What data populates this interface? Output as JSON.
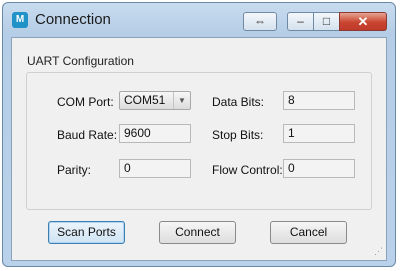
{
  "window": {
    "title": "Connection",
    "icon": "maxim-logo-icon",
    "buttons": {
      "switch": "⇔",
      "minimize": "–",
      "maximize": "□",
      "close": "✕"
    }
  },
  "group": {
    "title": "UART Configuration",
    "com_port": {
      "label": "COM Port:",
      "value": "COM51"
    },
    "data_bits": {
      "label": "Data Bits:",
      "value": "8"
    },
    "baud_rate": {
      "label": "Baud Rate:",
      "value": "9600"
    },
    "stop_bits": {
      "label": "Stop Bits:",
      "value": "1"
    },
    "parity": {
      "label": "Parity:",
      "value": "0"
    },
    "flow_control": {
      "label": "Flow Control:",
      "value": "0"
    }
  },
  "buttons": {
    "scan": "Scan Ports",
    "connect": "Connect",
    "cancel": "Cancel"
  }
}
